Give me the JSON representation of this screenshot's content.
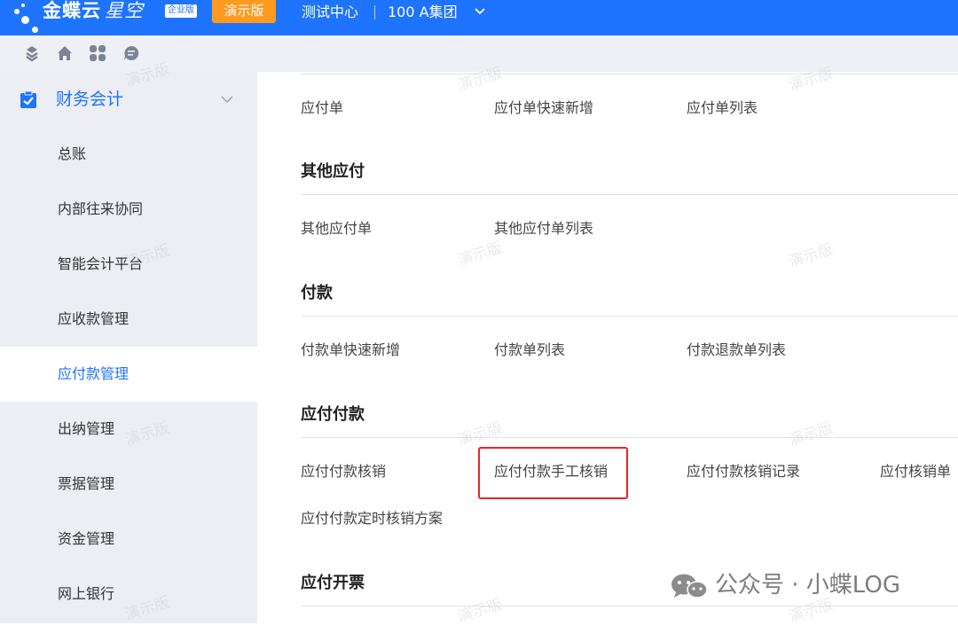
{
  "topbar": {
    "brand": "金蝶云",
    "brand_sub": "星空",
    "edition_badge": "企业版",
    "demo_badge": "演示版",
    "org_center": "测试中心",
    "org_group": "100 A集团"
  },
  "colors": {
    "accent": "#1e73ff",
    "demo_badge": "#ff9a1f",
    "highlight": "#e5262a"
  },
  "toolbar": {
    "icons": [
      "refresh-icon",
      "home-icon",
      "apps-icon",
      "chat-icon"
    ]
  },
  "sidebar": {
    "header": "财务会计",
    "items": [
      {
        "label": "总账"
      },
      {
        "label": "内部往来协同"
      },
      {
        "label": "智能会计平台"
      },
      {
        "label": "应收款管理"
      },
      {
        "label": "应付款管理",
        "active": true
      },
      {
        "label": "出纳管理"
      },
      {
        "label": "票据管理"
      },
      {
        "label": "资金管理"
      },
      {
        "label": "网上银行"
      }
    ]
  },
  "main": {
    "sections": [
      {
        "title": "",
        "links": [
          "应付单",
          "应付单快速新增",
          "应付单列表"
        ]
      },
      {
        "title": "其他应付",
        "links": [
          "其他应付单",
          "其他应付单列表"
        ]
      },
      {
        "title": "付款",
        "links": [
          "付款单快速新增",
          "付款单列表",
          "付款退款单列表"
        ]
      },
      {
        "title": "应付付款",
        "links": [
          "应付付款核销",
          "应付付款手工核销",
          "应付付款核销记录",
          "应付核销单",
          "应付付款定时核销方案"
        ]
      },
      {
        "title": "应付开票",
        "links": []
      }
    ],
    "highlighted_link": "应付付款手工核销"
  },
  "watermark": "演示版",
  "footer": {
    "wechat_account": "公众号 · 小蝶LOG"
  }
}
